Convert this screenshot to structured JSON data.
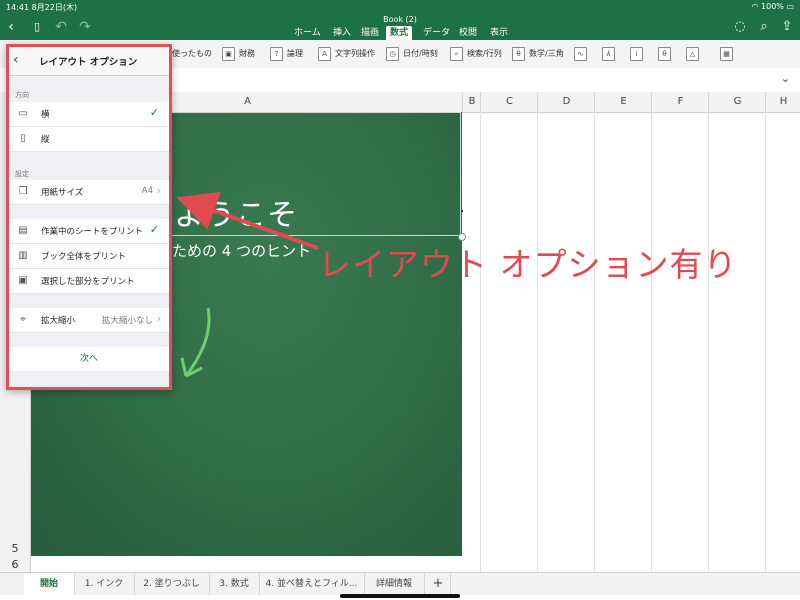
{
  "status_bar": {
    "time_date": "14:41  8月22日(木)",
    "battery": "100%"
  },
  "document": {
    "title": "Book (2)"
  },
  "ribbon_tabs": [
    "ホーム",
    "挿入",
    "描画",
    "数式",
    "データ",
    "校閲",
    "表示"
  ],
  "active_tab": "数式",
  "ribbon_buttons": [
    "使ったもの",
    "財務",
    "論理",
    "文字列操作",
    "日付/時刻",
    "検索/行列",
    "数学/三角"
  ],
  "columns": [
    "A",
    "B",
    "C",
    "D",
    "E",
    "F",
    "G",
    "H"
  ],
  "rows": [
    "5",
    "6"
  ],
  "sheet": {
    "welcome": "ようこそ",
    "subtitle": "ための 4 つのヒント"
  },
  "panel": {
    "title": "レイアウト オプション",
    "orientation_header": "方向",
    "orientation_options": [
      "横",
      "縦"
    ],
    "settings_header": "設定",
    "paper_size_label": "用紙サイズ",
    "paper_size_value": "A4",
    "print_options": [
      "作業中のシートをプリント",
      "ブック全体をプリント",
      "選択した部分をプリント"
    ],
    "scale_label": "拡大縮小",
    "scale_value": "拡大縮小なし",
    "next": "次へ"
  },
  "sheet_tabs": [
    "開始",
    "1. インク",
    "2. 塗りつぶし",
    "3. 数式",
    "4. 並べ替えとフィル...",
    "詳細情報"
  ],
  "add_sheet": "+",
  "annotation": {
    "text": "レイアウト オプション有り",
    "color": "#e24a52",
    "arrow_color": "#e24a52",
    "hint_arrow_color": "#6fcf6a"
  },
  "colors": {
    "excel_green": "#1e7145",
    "sheet_green": "#2f6b45"
  }
}
